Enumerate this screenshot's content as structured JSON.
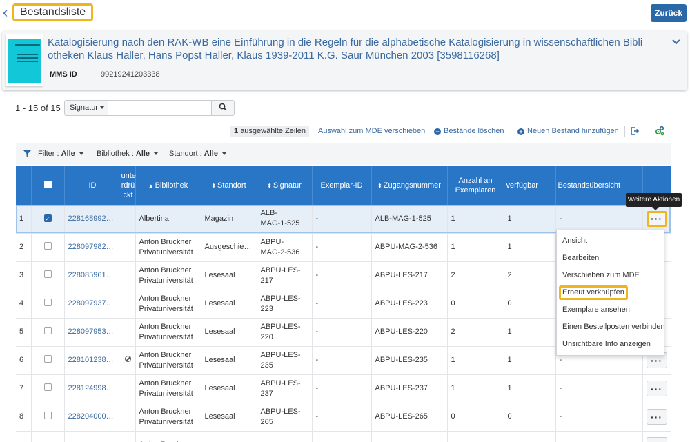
{
  "header": {
    "title": "Bestandsliste",
    "back_button": "Zurück"
  },
  "record": {
    "title": "Katalogisierung nach den RAK-WB eine Einführung in die Regeln für die alphabetische Katalogisierung in wissenschaftlichen Bibliotheken Klaus Haller, Hans Popst Haller, Klaus 1939-2011 K.G. Saur München 2003 [3598116268]",
    "title_line1": "Katalogisierung nach den RAK-WB eine Einführung in die Regeln für die alphabetische Katalogisierung in wissenschaftlichen Bibli",
    "title_line2": "otheken Klaus Haller, Hans Popst Haller, Klaus 1939-2011 K.G. Saur München 2003 [3598116268]",
    "mms_label": "MMS ID",
    "mms_value": "99219241203338"
  },
  "pager": {
    "range": "1 - 15 of 15",
    "field_select": "Signatur",
    "search_value": "",
    "search_placeholder": ""
  },
  "actions": {
    "selected_count": "1",
    "selected_label": "ausgewählte Zeilen",
    "move_to_mde": "Auswahl zum MDE verschieben",
    "delete_holdings": "Bestände löschen",
    "add_holding": "Neuen Bestand hinzufügen"
  },
  "filters": {
    "filter_label": "Filter :",
    "filter_value": "Alle",
    "library_label": "Bibliothek :",
    "library_value": "Alle",
    "location_label": "Standort :",
    "location_value": "Alle"
  },
  "table": {
    "columns": {
      "id": "ID",
      "suppressed_1": "unte",
      "suppressed_2": "rdrü",
      "suppressed_3": "ckt",
      "library": "Bibliothek",
      "location": "Standort",
      "call_number": "Signatur",
      "item_id": "Exemplar-ID",
      "accession": "Zugangsnummer",
      "count_1": "Anzahl an",
      "count_2": "Exemplaren",
      "available": "verfügbar",
      "summary": "Bestandsübersicht"
    },
    "rows": [
      {
        "num": "1",
        "id": "228168992000...",
        "lib1": "Albertina",
        "lib2": "",
        "location": "Magazin",
        "sig1": "ALB-",
        "sig2": "MAG-1-525",
        "item": "-",
        "accession": "ALB-MAG-1-525",
        "count": "1",
        "avail": "1",
        "summary": "-"
      },
      {
        "num": "2",
        "id": "228097982000...",
        "lib1": "Anton Bruckner",
        "lib2": "Privatuniversität",
        "location": "Ausgeschied...",
        "sig1": "ABPU-",
        "sig2": "MAG-2-536",
        "item": "-",
        "accession": "ABPU-MAG-2-536",
        "count": "1",
        "avail": "1",
        "summary": ""
      },
      {
        "num": "3",
        "id": "228085961000...",
        "lib1": "Anton Bruckner",
        "lib2": "Privatuniversität",
        "location": "Lesesaal",
        "sig1": "ABPU-LES-217",
        "sig2": "",
        "item": "-",
        "accession": "ABPU-LES-217",
        "count": "2",
        "avail": "2",
        "summary": ""
      },
      {
        "num": "4",
        "id": "228097937000...",
        "lib1": "Anton Bruckner",
        "lib2": "Privatuniversität",
        "location": "Lesesaal",
        "sig1": "ABPU-LES-223",
        "sig2": "",
        "item": "-",
        "accession": "ABPU-LES-223",
        "count": "0",
        "avail": "0",
        "summary": ""
      },
      {
        "num": "5",
        "id": "228097953000...",
        "lib1": "Anton Bruckner",
        "lib2": "Privatuniversität",
        "location": "Lesesaal",
        "sig1": "ABPU-LES-220",
        "sig2": "",
        "item": "-",
        "accession": "ABPU-LES-220",
        "count": "2",
        "avail": "1",
        "summary": ""
      },
      {
        "num": "6",
        "id": "228101238000...",
        "lib1": "Anton Bruckner",
        "lib2": "Privatuniversität",
        "location": "Lesesaal",
        "sig1": "ABPU-LES-235",
        "sig2": "",
        "item": "-",
        "accession": "ABPU-LES-235",
        "count": "1",
        "avail": "1",
        "summary": "-"
      },
      {
        "num": "7",
        "id": "228124998000...",
        "lib1": "Anton Bruckner",
        "lib2": "Privatuniversität",
        "location": "Lesesaal",
        "sig1": "ABPU-LES-237",
        "sig2": "",
        "item": "-",
        "accession": "ABPU-LES-237",
        "count": "1",
        "avail": "1",
        "summary": "-"
      },
      {
        "num": "8",
        "id": "228204000000...",
        "lib1": "Anton Bruckner",
        "lib2": "Privatuniversität",
        "location": "Lesesaal",
        "sig1": "ABPU-LES-265",
        "sig2": "",
        "item": "-",
        "accession": "ABPU-LES-265",
        "count": "0",
        "avail": "0",
        "summary": "-"
      },
      {
        "num": "",
        "id": "",
        "lib1": "Anton Bruckner",
        "lib2": "",
        "location": "",
        "sig1": "",
        "sig2": "",
        "item": "",
        "accession": "",
        "count": "",
        "avail": "",
        "summary": ""
      }
    ]
  },
  "tooltip": "Weitere Aktionen",
  "menu": {
    "items": [
      "Ansicht",
      "Bearbeiten",
      "Verschieben zum MDE",
      "Erneut verknüpfen",
      "Exemplare ansehen",
      "Einen Bestellposten verbinden",
      "Unsichtbare Info anzeigen"
    ]
  },
  "colors": {
    "accent": "#2a68a8",
    "table_header": "#2a76c6",
    "highlight": "#f0b41c",
    "link": "#3b6aa0"
  }
}
